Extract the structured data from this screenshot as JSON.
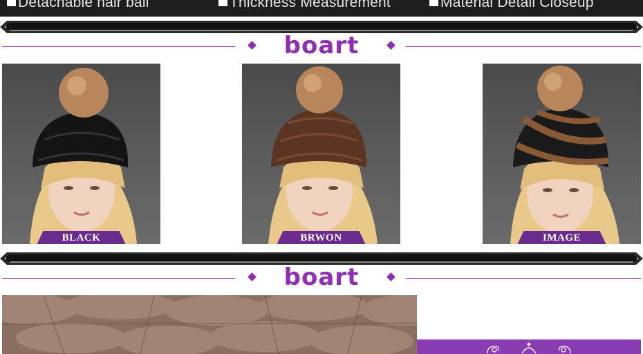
{
  "features": [
    {
      "label": "Detachable hair ball"
    },
    {
      "label": "Thickness Measurement"
    },
    {
      "label": "Material Detail Closeup"
    }
  ],
  "brand": {
    "logo_text": "boart",
    "color": "#8e2fb4"
  },
  "products": [
    {
      "label": "BLACK",
      "hat_color": "#141414",
      "stripe_color": "#141414"
    },
    {
      "label": "BRWON",
      "hat_color": "#5b3522",
      "stripe_color": "#5b3522"
    },
    {
      "label": "IMAGE",
      "hat_color": "#1a1a1a",
      "stripe_color": "#8a5a36"
    }
  ],
  "colors": {
    "label_bg": "#6a2b8f",
    "top_bar": "#1e1e1e",
    "pompom": "#b8865a"
  }
}
